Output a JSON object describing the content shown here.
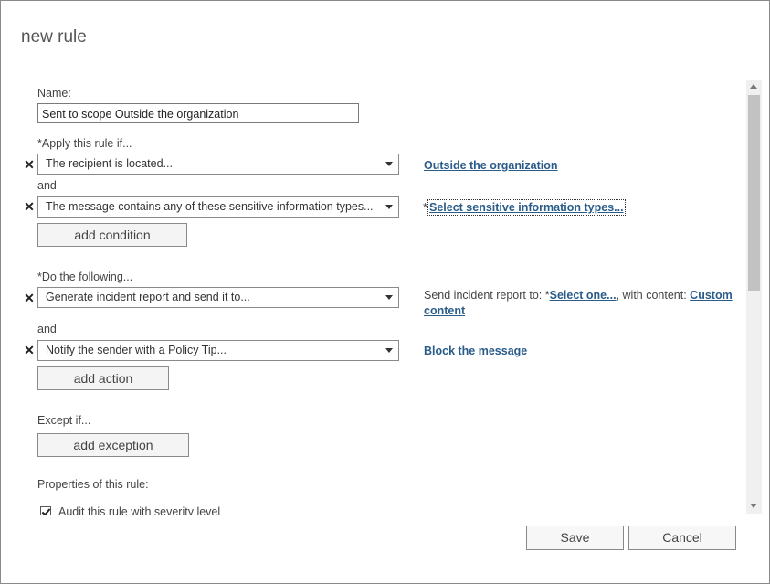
{
  "dialog": {
    "title": "new rule"
  },
  "form": {
    "name_label": "Name:",
    "name_value": "Sent to scope Outside the organization",
    "apply_label": "*Apply this rule if...",
    "conditions": [
      {
        "dropdown": "The recipient is located...",
        "link": "Outside the organization"
      },
      {
        "dropdown": "The message contains any of these sensitive information types...",
        "link_prefix": "*",
        "link": "Select sensitive information types..."
      }
    ],
    "and_label": "and",
    "add_condition": "add condition",
    "do_label": "*Do the following...",
    "actions": [
      {
        "dropdown": "Generate incident report and send it to...",
        "desc_prefix": "Send incident report to: ",
        "desc_required_marker": "*",
        "desc_link1": "Select one...",
        "desc_middle": ", with content: ",
        "desc_link2": "Custom content"
      },
      {
        "dropdown": "Notify the sender with a Policy Tip...",
        "link": "Block the message"
      }
    ],
    "add_action": "add action",
    "except_label": "Except if...",
    "add_exception": "add exception",
    "properties_label": "Properties of this rule:",
    "audit_checkbox_label": "Audit this rule with severity level",
    "audit_checked": true
  },
  "footer": {
    "save": "Save",
    "cancel": "Cancel"
  }
}
